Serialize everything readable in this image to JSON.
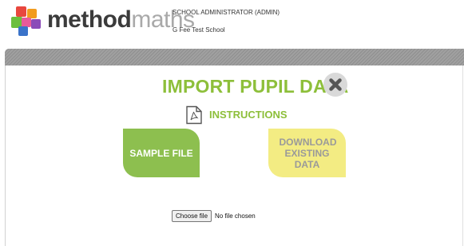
{
  "header": {
    "logo": {
      "word_bold": "method",
      "word_light": "maths"
    },
    "user_role": "SCHOOL ADMINISTRATOR (ADMIN)",
    "school_name": "G Fee Test School"
  },
  "main": {
    "title": "IMPORT PUPIL DATA",
    "close_icon": "close-x-icon",
    "instructions": {
      "icon": "pdf-document-icon",
      "label": "INSTRUCTIONS"
    },
    "sample_button": "SAMPLE FILE",
    "download_button": "DOWNLOAD EXISTING DATA",
    "file_input": {
      "button_label": "Choose file",
      "status": "No file chosen"
    }
  },
  "colors": {
    "brand_green": "#8dbf3a",
    "sample_button_bg": "#8dbf4f",
    "download_button_bg": "#f3ec83",
    "logo_red": "#e8473e",
    "logo_orange": "#f29c1f",
    "logo_green": "#6cbf3d",
    "logo_blue": "#3a73c9"
  }
}
